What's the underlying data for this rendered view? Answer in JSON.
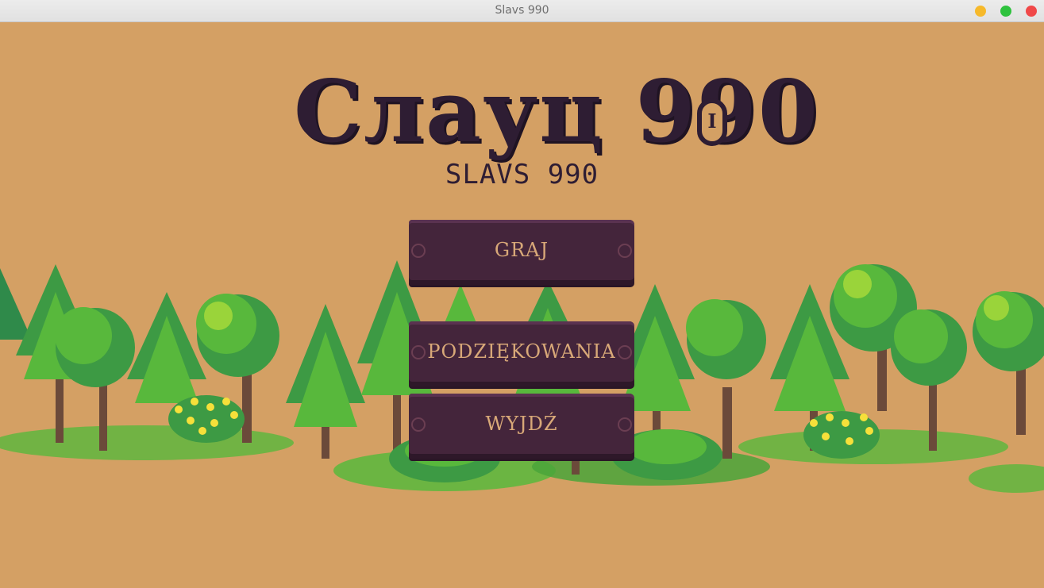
{
  "window": {
    "title": "Slavs 990"
  },
  "colors": {
    "background": "#d4a064",
    "button_wood": "#44253b",
    "button_text": "#d8a878",
    "logo": "#2e1d33",
    "tree_dark": "#2f8a4a",
    "tree_mid": "#58b83c",
    "tree_light": "#9ad43a",
    "flower": "#f6e03a"
  },
  "logo": {
    "text": "Слауц 990"
  },
  "subtitle": "SLAVS 990",
  "menu": {
    "play": "GRAJ",
    "credits": "PODZIĘKOWANIA",
    "quit": "WYJDŹ"
  }
}
